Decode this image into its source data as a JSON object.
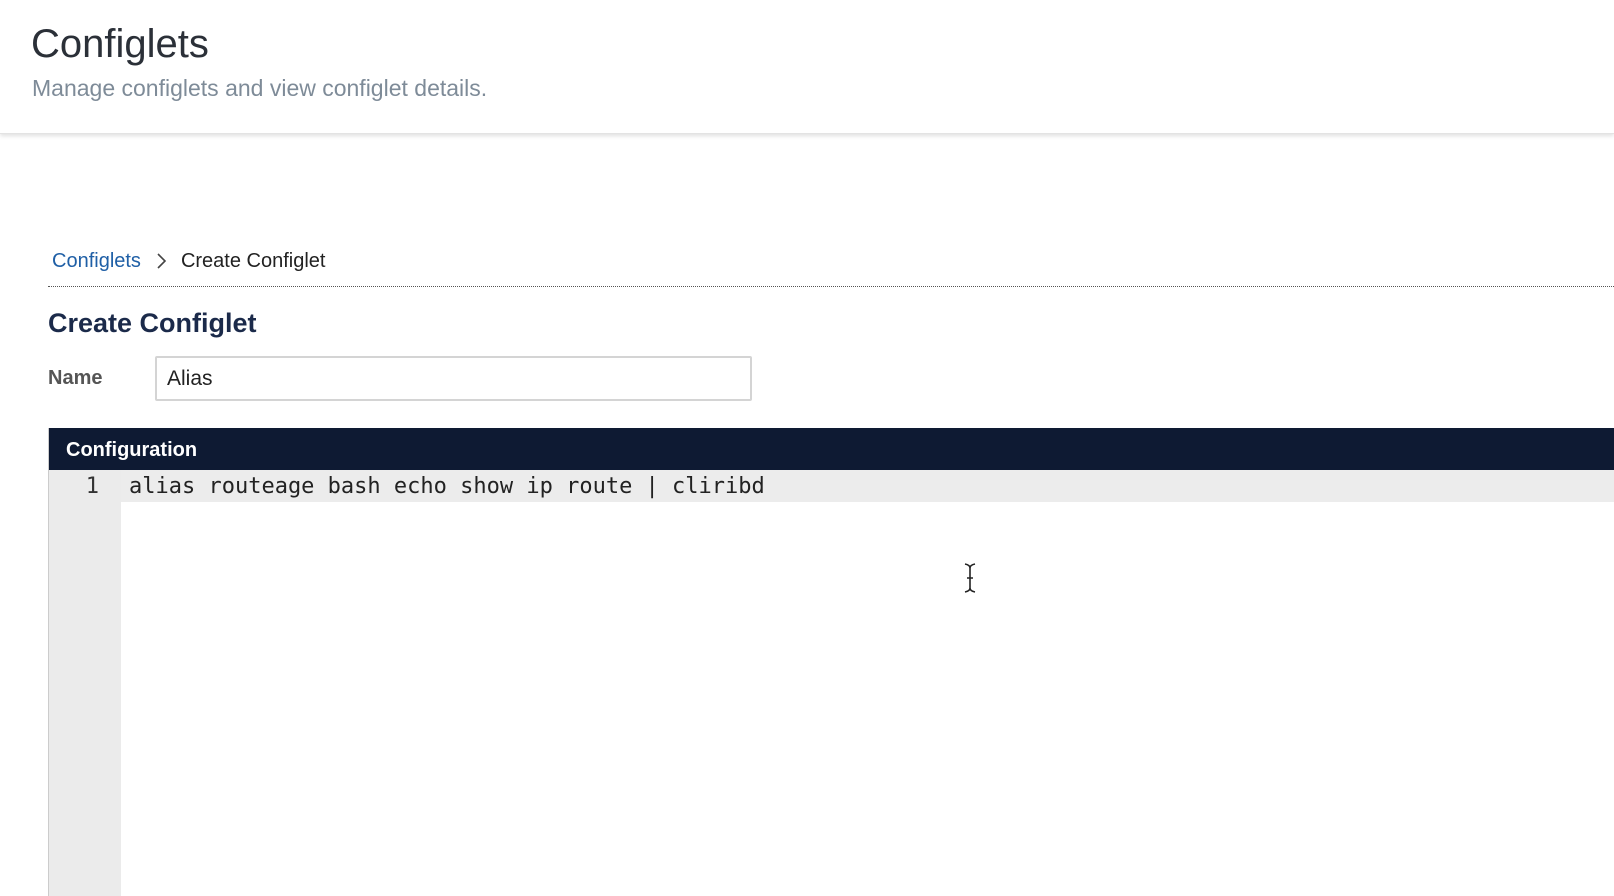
{
  "header": {
    "title": "Configlets",
    "subtitle": "Manage configlets and view configlet details."
  },
  "breadcrumb": {
    "parent": "Configlets",
    "separator_icon": "chevron-right-icon",
    "current": "Create Configlet"
  },
  "form": {
    "title": "Create Configlet",
    "name_label": "Name",
    "name_value": "Alias"
  },
  "configuration": {
    "header": "Configuration",
    "lines": [
      {
        "number": "1",
        "text": "alias routeage bash echo show ip route | cliribd"
      }
    ]
  },
  "colors": {
    "config_header_bg": "#0e1a33",
    "link": "#1f5fa6",
    "section_title": "#1b2a4a"
  },
  "cursor_icon": "text-cursor-icon"
}
